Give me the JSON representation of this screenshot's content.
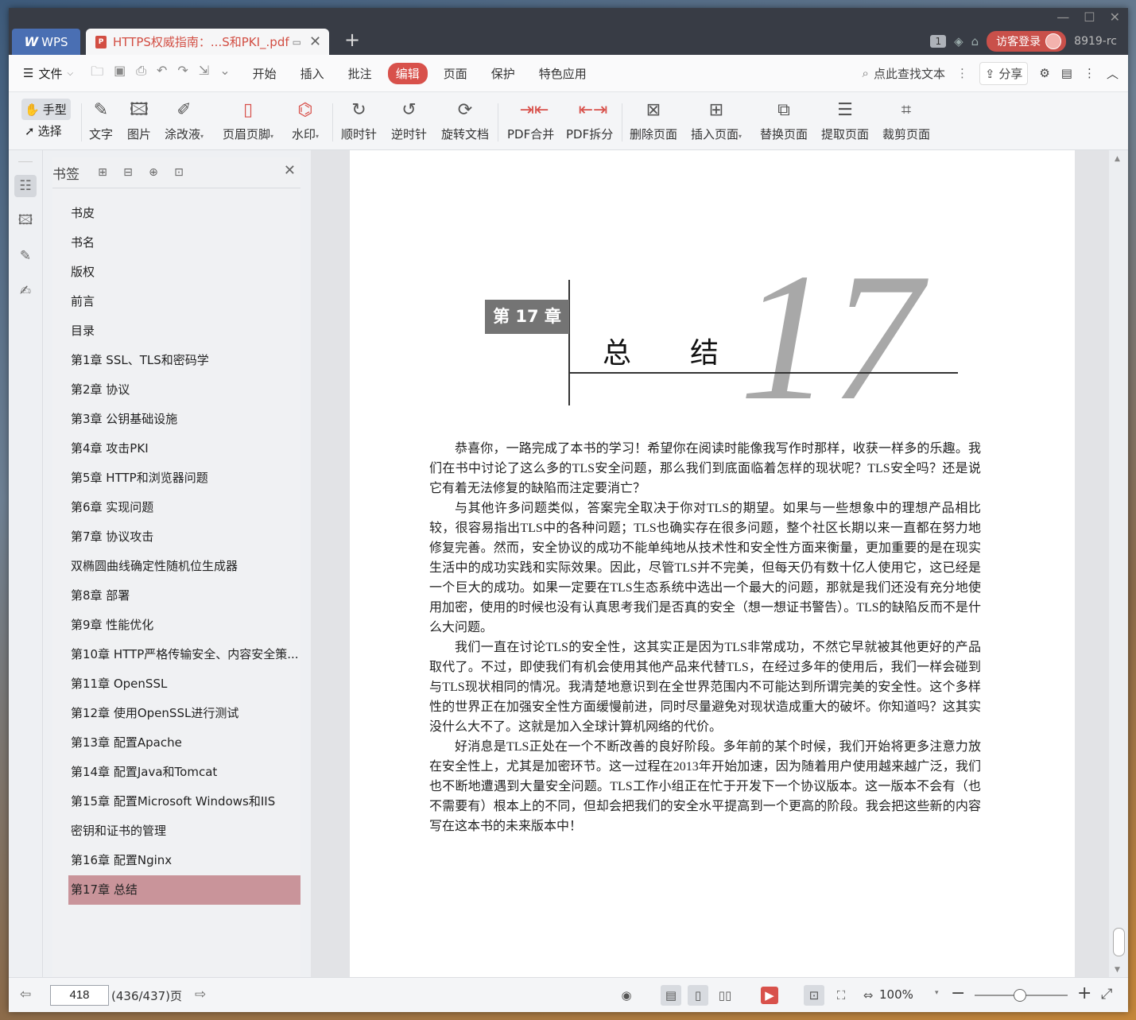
{
  "window": {
    "minimize": "—",
    "maximize": "☐",
    "close": "✕"
  },
  "titlebar": {
    "app_tab": "WPS",
    "app_logo": "W",
    "doc_tab": "HTTPS权威指南：...S和PKI_.pdf",
    "doc_badge": "P",
    "badge_count": "1",
    "visitor_login": "访客登录",
    "user_id": "8919-rc"
  },
  "menubar": {
    "file": "文件",
    "tabs": [
      "开始",
      "插入",
      "批注",
      "编辑",
      "页面",
      "保护",
      "特色应用"
    ],
    "active_tab": "编辑",
    "search": "点此查找文本",
    "share": "分享"
  },
  "ribbon": {
    "hand": "手型",
    "select": "选择",
    "items": [
      {
        "label": "文字",
        "icon": "text-edit-icon"
      },
      {
        "label": "图片",
        "icon": "image-edit-icon"
      },
      {
        "label": "涂改液",
        "icon": "correction-fluid-icon"
      },
      {
        "label": "页眉页脚",
        "icon": "header-footer-icon"
      },
      {
        "label": "水印",
        "icon": "watermark-icon"
      },
      {
        "label": "顺时针",
        "icon": "rotate-clockwise-icon"
      },
      {
        "label": "逆时针",
        "icon": "rotate-counterclockwise-icon"
      },
      {
        "label": "旋转文档",
        "icon": "rotate-document-icon"
      },
      {
        "label": "PDF合并",
        "icon": "pdf-merge-icon"
      },
      {
        "label": "PDF拆分",
        "icon": "pdf-split-icon"
      },
      {
        "label": "删除页面",
        "icon": "delete-page-icon"
      },
      {
        "label": "插入页面",
        "icon": "insert-page-icon"
      },
      {
        "label": "替换页面",
        "icon": "replace-page-icon"
      },
      {
        "label": "提取页面",
        "icon": "extract-page-icon"
      },
      {
        "label": "裁剪页面",
        "icon": "crop-page-icon"
      }
    ]
  },
  "bookmarks": {
    "title": "书签",
    "items": [
      {
        "label": "书皮",
        "expandable": false
      },
      {
        "label": "书名",
        "expandable": false
      },
      {
        "label": "版权",
        "expandable": false
      },
      {
        "label": "前言",
        "expandable": false
      },
      {
        "label": "目录",
        "expandable": false
      },
      {
        "label": "第1章 SSL、TLS和密码学",
        "expandable": true
      },
      {
        "label": "第2章 协议",
        "expandable": true
      },
      {
        "label": "第3章 公钥基础设施",
        "expandable": true
      },
      {
        "label": "第4章 攻击PKI",
        "expandable": true
      },
      {
        "label": "第5章 HTTP和浏览器问题",
        "expandable": true
      },
      {
        "label": "第6章 实现问题",
        "expandable": true
      },
      {
        "label": "第7章 协议攻击",
        "expandable": true
      },
      {
        "label": "双椭圆曲线确定性随机位生成器",
        "expandable": false
      },
      {
        "label": "第8章 部署",
        "expandable": true
      },
      {
        "label": "第9章 性能优化",
        "expandable": true
      },
      {
        "label": "第10章 HTTP严格传输安全、内容安全策...",
        "expandable": true
      },
      {
        "label": "第11章 OpenSSL",
        "expandable": true
      },
      {
        "label": "第12章 使用OpenSSL进行测试",
        "expandable": true
      },
      {
        "label": "第13章 配置Apache",
        "expandable": true
      },
      {
        "label": "第14章 配置Java和Tomcat",
        "expandable": true
      },
      {
        "label": "第15章 配置Microsoft Windows和IIS",
        "expandable": true
      },
      {
        "label": "密钥和证书的管理",
        "expandable": false
      },
      {
        "label": "第16章 配置Nginx",
        "expandable": true
      },
      {
        "label": "第17章 总结",
        "expandable": false
      }
    ],
    "selected": "第17章 总结"
  },
  "page": {
    "chapter_label": "第 17 章",
    "chapter_title": "总结",
    "chapter_number": "17",
    "paragraphs": [
      "恭喜你，一路完成了本书的学习！希望你在阅读时能像我写作时那样，收获一样多的乐趣。我们在书中讨论了这么多的TLS安全问题，那么我们到底面临着怎样的现状呢？TLS安全吗？还是说它有着无法修复的缺陷而注定要消亡？",
      "与其他许多问题类似，答案完全取决于你对TLS的期望。如果与一些想象中的理想产品相比较，很容易指出TLS中的各种问题；TLS也确实存在很多问题，整个社区长期以来一直都在努力地修复完善。然而，安全协议的成功不能单纯地从技术性和安全性方面来衡量，更加重要的是在现实生活中的成功实践和实际效果。因此，尽管TLS并不完美，但每天仍有数十亿人使用它，这已经是一个巨大的成功。如果一定要在TLS生态系统中选出一个最大的问题，那就是我们还没有充分地使用加密，使用的时候也没有认真思考我们是否真的安全（想一想证书警告）。TLS的缺陷反而不是什么大问题。",
      "我们一直在讨论TLS的安全性，这其实正是因为TLS非常成功，不然它早就被其他更好的产品取代了。不过，即使我们有机会使用其他产品来代替TLS，在经过多年的使用后，我们一样会碰到与TLS现状相同的情况。我清楚地意识到在全世界范围内不可能达到所谓完美的安全性。这个多样性的世界正在加强安全性方面缓慢前进，同时尽量避免对现状造成重大的破坏。你知道吗？这其实没什么大不了。这就是加入全球计算机网络的代价。",
      "好消息是TLS正处在一个不断改善的良好阶段。多年前的某个时候，我们开始将更多注意力放在安全性上，尤其是加密环节。这一过程在2013年开始加速，因为随着用户使用越来越广泛，我们也不断地遭遇到大量安全问题。TLS工作小组正在忙于开发下一个协议版本。这一版本不会有（也不需要有）根本上的不同，但却会把我们的安全水平提高到一个更高的阶段。我会把这些新的内容写在这本书的未来版本中！"
    ]
  },
  "statusbar": {
    "current_page": "418",
    "page_total": "(436/437)页",
    "zoom": "100%"
  },
  "colors": {
    "accent": "#d8514b",
    "titlebar": "#383c45",
    "bookmark_selected": "#c9949a",
    "chapter_box": "#747474",
    "chapter_number": "#a8a8a8"
  }
}
